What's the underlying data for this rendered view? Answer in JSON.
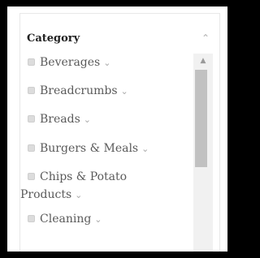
{
  "filter": {
    "title": "Category",
    "collapse_icon": "chevron-up-icon",
    "items": [
      {
        "label": "Beverages",
        "icon": "chevron-down-icon"
      },
      {
        "label": "Breadcrumbs",
        "icon": "chevron-down-icon"
      },
      {
        "label": "Breads",
        "icon": "chevron-down-icon"
      },
      {
        "label": "Burgers & Meals",
        "icon": "chevron-down-icon"
      },
      {
        "label": "Chips & Potato",
        "label_cont": "Products",
        "icon": "chevron-down-icon"
      },
      {
        "label": "Cleaning",
        "icon": "chevron-down-icon"
      }
    ]
  },
  "colors": {
    "frame": "#000000",
    "panel": "#ffffff",
    "text": "#5a5a5a",
    "title": "#222222",
    "chevron": "#a8a8a8",
    "checkbox": "#dcdcdc",
    "scroll_track": "#f1f1f1",
    "scroll_thumb": "#c1c1c1"
  }
}
